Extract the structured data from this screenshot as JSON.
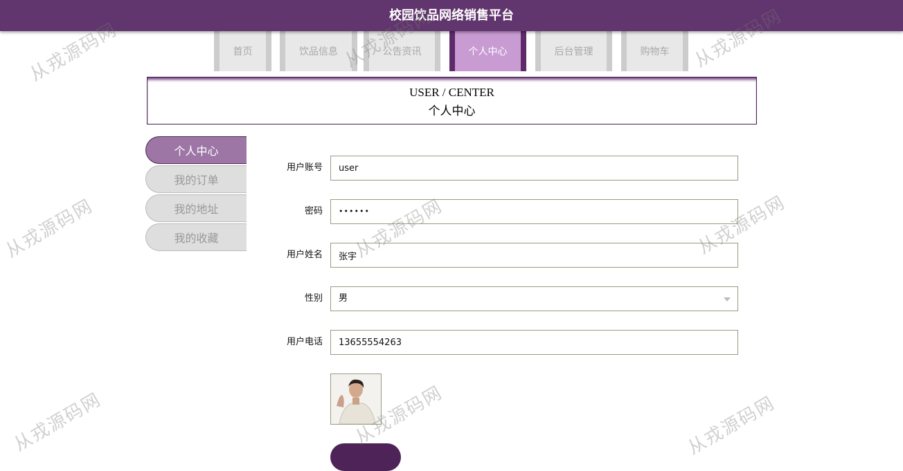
{
  "header": {
    "title": "校园饮品网络销售平台"
  },
  "nav": {
    "items": [
      {
        "label": "首页"
      },
      {
        "label": "饮品信息"
      },
      {
        "label": "公告资讯"
      },
      {
        "label": "个人中心"
      },
      {
        "label": "后台管理"
      },
      {
        "label": "购物车"
      }
    ],
    "active": "个人中心"
  },
  "banner": {
    "en": "USER / CENTER",
    "cn": "个人中心"
  },
  "sidebar": {
    "items": [
      {
        "label": "个人中心"
      },
      {
        "label": "我的订单"
      },
      {
        "label": "我的地址"
      },
      {
        "label": "我的收藏"
      }
    ],
    "active": "个人中心"
  },
  "form": {
    "account": {
      "label": "用户账号",
      "value": "user"
    },
    "password": {
      "label": "密码",
      "value": "••••••"
    },
    "name": {
      "label": "用户姓名",
      "value": "张宇"
    },
    "gender": {
      "label": "性别",
      "value": "男"
    },
    "phone": {
      "label": "用户电话",
      "value": "13655554263"
    }
  },
  "watermark": "从戎源码网",
  "colors": {
    "primary": "#61356d",
    "active_tab": "#c99bd3",
    "side_active": "#9d76a6"
  }
}
